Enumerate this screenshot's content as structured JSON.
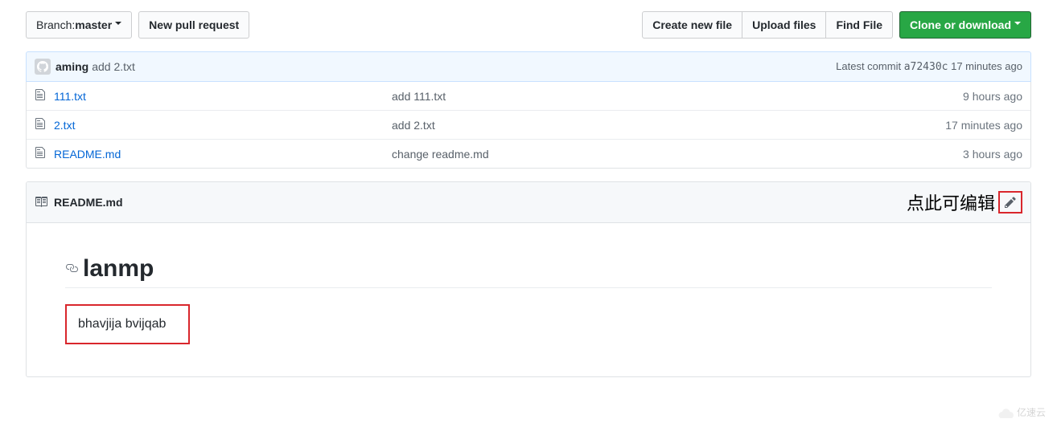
{
  "toolbar": {
    "branch_label": "Branch: ",
    "branch_name": "master",
    "new_pr": "New pull request",
    "create_file": "Create new file",
    "upload": "Upload files",
    "find": "Find File",
    "clone": "Clone or download"
  },
  "commit": {
    "author": "aming",
    "message": "add 2.txt",
    "latest_label": "Latest commit ",
    "sha": "a72430c",
    "time": " 17 minutes ago"
  },
  "files": [
    {
      "name": "111.txt",
      "commit_msg": "add 111.txt",
      "age": "9 hours ago"
    },
    {
      "name": "2.txt",
      "commit_msg": "add 2.txt",
      "age": "17 minutes ago"
    },
    {
      "name": "README.md",
      "commit_msg": "change readme.md",
      "age": "3 hours ago"
    }
  ],
  "readme": {
    "filename": "README.md",
    "edit_annotation": "点此可编辑",
    "heading": "lanmp",
    "content": "bhavjija bvijqab"
  },
  "watermark": "亿速云"
}
